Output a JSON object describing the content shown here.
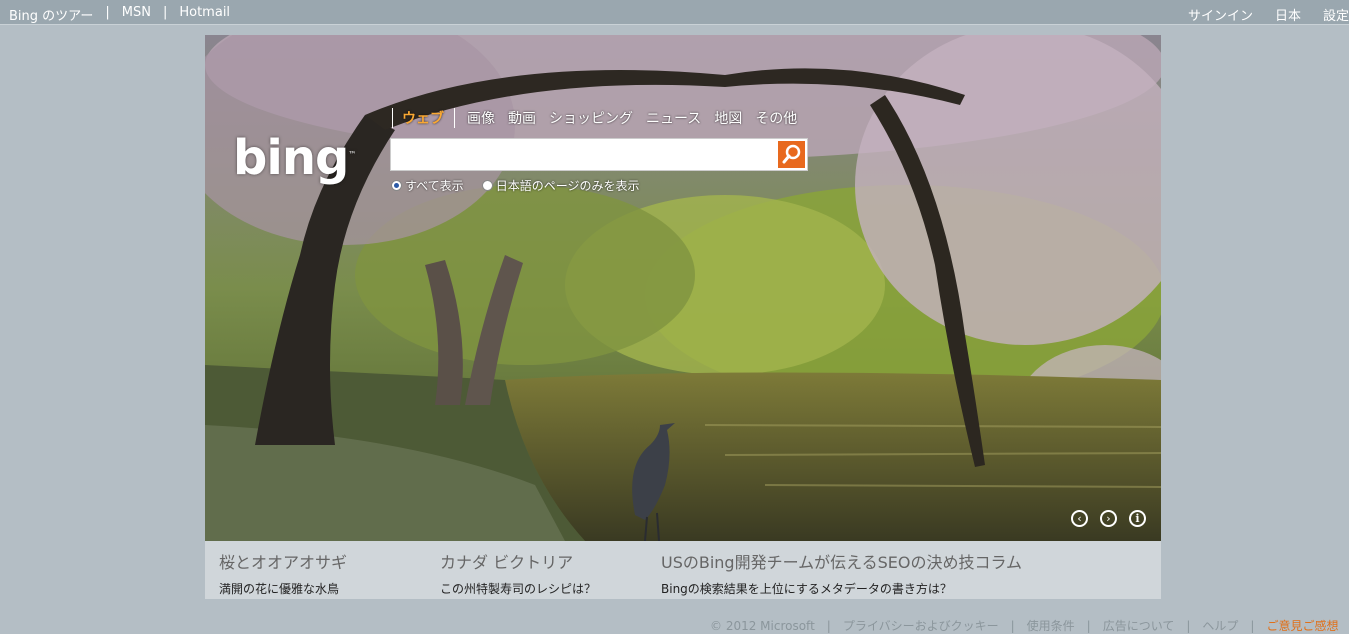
{
  "topbar": {
    "left_links": [
      "Bing のツアー",
      "MSN",
      "Hotmail"
    ],
    "right_links": [
      "サインイン",
      "日本",
      "設定"
    ]
  },
  "logo": {
    "text": "bing",
    "tm": "™"
  },
  "nav": {
    "items": [
      "ウェブ",
      "画像",
      "動画",
      "ショッピング",
      "ニュース",
      "地図",
      "その他"
    ],
    "active": "ウェブ"
  },
  "search": {
    "value": "",
    "button_icon": "search-icon"
  },
  "radio_options": [
    {
      "label": "すべて表示",
      "selected": true
    },
    {
      "label": "日本語のページのみを表示",
      "selected": false
    }
  ],
  "hero_controls": [
    "previous-image-icon",
    "next-image-icon",
    "info-icon"
  ],
  "stories": [
    {
      "title": "桜とオオアオサギ",
      "subtitle": "満開の花に優雅な水鳥"
    },
    {
      "title": "カナダ ビクトリア",
      "subtitle": "この州特製寿司のレシピは？"
    },
    {
      "title": "USのBing開発チームが伝えるSEOの決め技コラム",
      "subtitle": "Bingの検索結果を上位にするメタデータの書き方は？"
    }
  ],
  "footer": {
    "copyright": "© 2012 Microsoft",
    "links": [
      "プライバシーおよびクッキー",
      "使用条件",
      "広告について",
      "ヘルプ"
    ],
    "feedback": "ご意見ご感想"
  },
  "colors": {
    "page_bg": "#b4bec5",
    "topbar_bg": "#9aa7af",
    "accent": "#f9a833",
    "search_button": "#e8691e",
    "panel_bg": "#d0d6da"
  }
}
